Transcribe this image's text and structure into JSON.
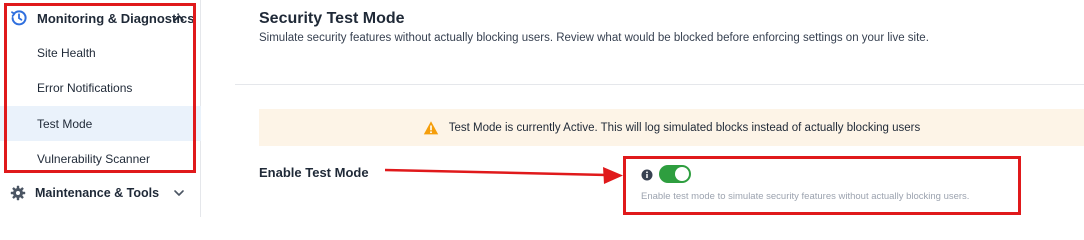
{
  "sidebar": {
    "group": {
      "label": "Monitoring & Diagnostics",
      "icon": "clock-history-icon",
      "expanded": true,
      "items": [
        {
          "label": "Site Health"
        },
        {
          "label": "Error Notifications"
        },
        {
          "label": "Test Mode",
          "active": true
        },
        {
          "label": "Vulnerability Scanner"
        }
      ]
    },
    "maintenance": {
      "label": "Maintenance & Tools",
      "icon": "gear-icon",
      "expanded": false
    }
  },
  "main": {
    "title": "Security Test Mode",
    "subtitle": "Simulate security features without actually blocking users. Review what would be blocked before enforcing settings on your live site.",
    "alert": {
      "icon": "warning-triangle-icon",
      "text": "Test Mode is currently Active. This will log simulated blocks instead of actually blocking users"
    },
    "setting": {
      "label": "Enable Test Mode",
      "info_icon": "info-icon",
      "toggle_on": true,
      "description": "Enable test mode to simulate security features without actually blocking users."
    }
  },
  "colors": {
    "accent_blue": "#2f6fde",
    "toggle_green": "#2e9e3f",
    "annotation_red": "#e0191b",
    "alert_bg": "#fdf4e7",
    "warning_orange": "#f59e0b",
    "active_item_bg": "#eaf2fb"
  }
}
